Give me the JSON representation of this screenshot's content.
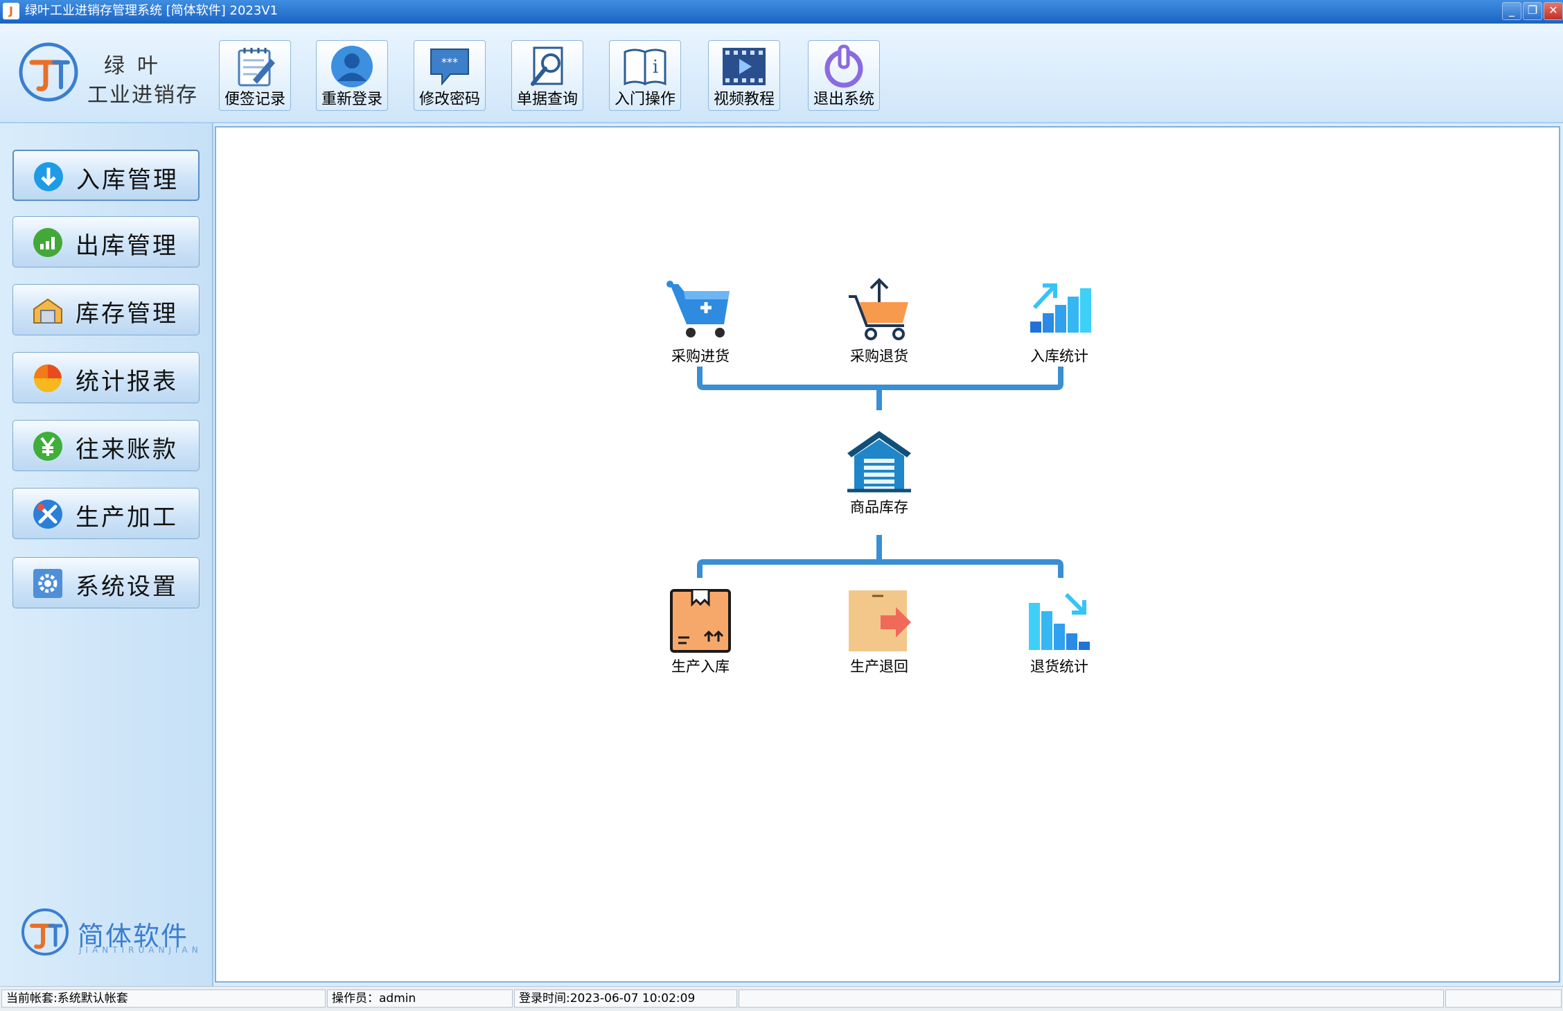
{
  "window": {
    "title": "绿叶工业进销存管理系统 [简体软件] 2023V1",
    "app_icon_letter": "J",
    "minimize_label": "_",
    "restore_label": "❐",
    "close_label": "✕"
  },
  "brand": {
    "line1": "绿叶",
    "line2": "工业进销存",
    "bottom_name": "简体软件",
    "bottom_sub": "JIANTIRUANJIAN"
  },
  "toolbar": {
    "buttons": [
      {
        "label": "便签记录",
        "icon": "notepad-icon"
      },
      {
        "label": "重新登录",
        "icon": "user-icon"
      },
      {
        "label": "修改密码",
        "icon": "password-chat-icon"
      },
      {
        "label": "单据查询",
        "icon": "document-search-icon"
      },
      {
        "label": "入门操作",
        "icon": "info-book-icon"
      },
      {
        "label": "视频教程",
        "icon": "video-icon"
      },
      {
        "label": "退出系统",
        "icon": "power-icon"
      }
    ]
  },
  "sidebar": {
    "items": [
      {
        "label": "入库管理",
        "icon": "arrow-down-circle-icon",
        "active": true
      },
      {
        "label": "出库管理",
        "icon": "bar-chart-circle-icon"
      },
      {
        "label": "库存管理",
        "icon": "warehouse-box-icon"
      },
      {
        "label": "统计报表",
        "icon": "pie-chart-icon"
      },
      {
        "label": "往来账款",
        "icon": "yen-circle-icon"
      },
      {
        "label": "生产加工",
        "icon": "tools-icon"
      },
      {
        "label": "系统设置",
        "icon": "gear-icon"
      }
    ]
  },
  "flow": {
    "top": [
      {
        "label": "采购进货",
        "icon": "cart-add-icon"
      },
      {
        "label": "采购退货",
        "icon": "cart-return-icon"
      },
      {
        "label": "入库统计",
        "icon": "stats-up-icon"
      }
    ],
    "center": {
      "label": "商品库存",
      "icon": "warehouse-icon"
    },
    "bottom": [
      {
        "label": "生产入库",
        "icon": "box-in-icon"
      },
      {
        "label": "生产退回",
        "icon": "box-return-icon"
      },
      {
        "label": "退货统计",
        "icon": "stats-down-icon"
      }
    ]
  },
  "status": {
    "account": "当前帐套:系统默认帐套",
    "operator": "操作员：admin",
    "login_time": "登录时间:2023-06-07 10:02:09",
    "extra1": "",
    "extra2": ""
  },
  "colors": {
    "accent": "#1a63c4",
    "connector": "#3a8ed4",
    "brand_blue": "#3a7ed0",
    "brand_orange": "#e8702a"
  }
}
